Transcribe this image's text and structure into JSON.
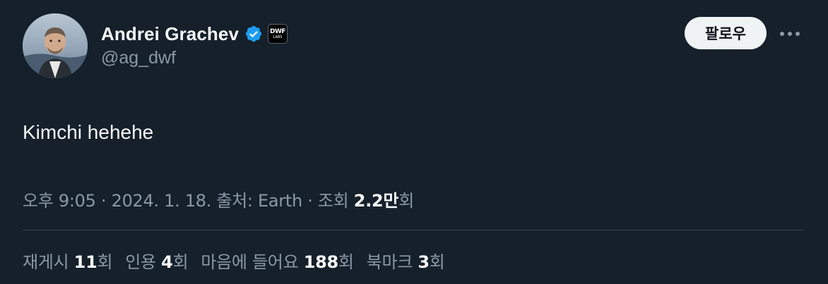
{
  "user": {
    "display_name": "Andrei Grachev",
    "handle": "@ag_dwf",
    "affiliate_badge_line1": "DWF",
    "affiliate_badge_line2": "LABS"
  },
  "icons": {
    "avatar": "profile-photo",
    "verified": "verified-badge-icon",
    "more": "more-horizontal-icon",
    "affiliate": "dwf-labs-affiliate-icon"
  },
  "actions": {
    "follow_label": "팔로우"
  },
  "tweet": {
    "text": "Kimchi hehehe"
  },
  "meta": {
    "time": "오후 9:05",
    "sep1": " · ",
    "date": "2024. 1. 18.",
    "source_label": " 출처: Earth",
    "sep2": " · ",
    "views_prefix": "조회 ",
    "views_value": "2.2만",
    "views_suffix": "회"
  },
  "stats": [
    {
      "label": "재게시 ",
      "value": "11",
      "suffix": "회"
    },
    {
      "label": "인용 ",
      "value": "4",
      "suffix": "회"
    },
    {
      "label": "마음에 들어요 ",
      "value": "188",
      "suffix": "회"
    },
    {
      "label": "북마크 ",
      "value": "3",
      "suffix": "회"
    }
  ],
  "colors": {
    "background": "#15202b",
    "primary_text": "#f7f9f9",
    "secondary_text": "#8b98a5",
    "verified_blue": "#1d9bf0",
    "divider": "#38444d",
    "follow_bg": "#eff3f4"
  }
}
